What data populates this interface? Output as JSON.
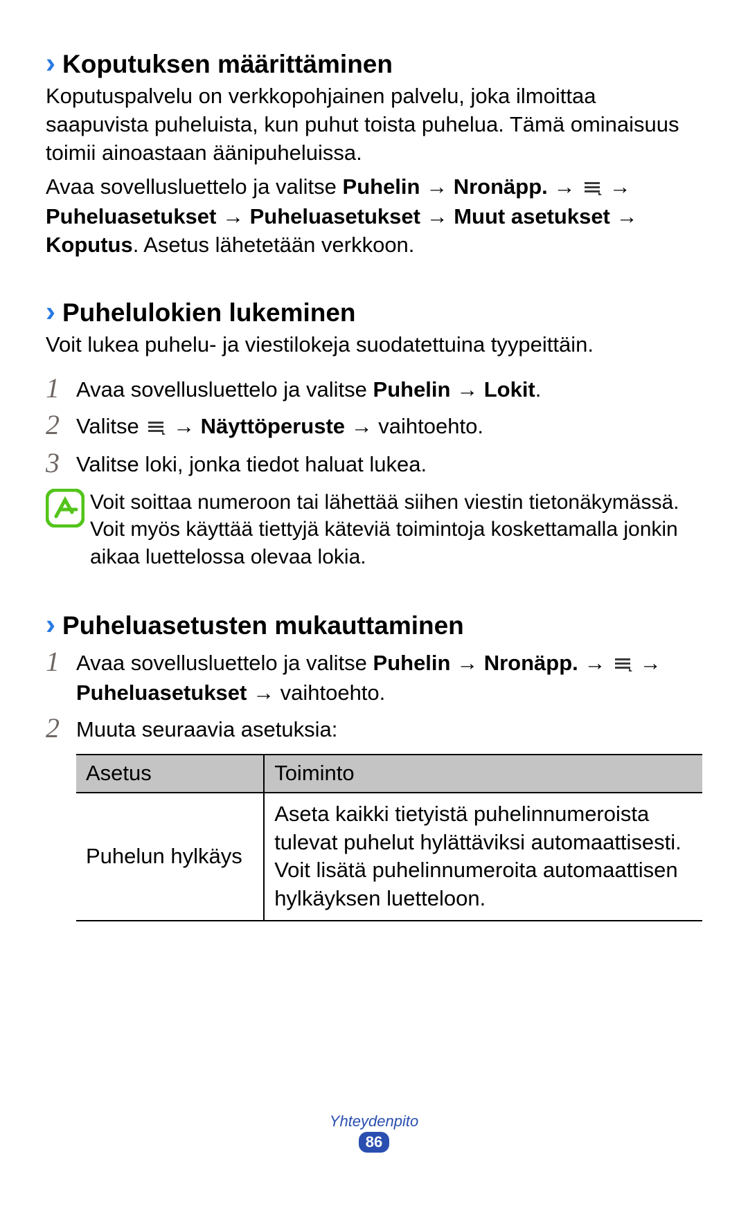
{
  "sections": {
    "s1": {
      "heading": "Koputuksen määrittäminen",
      "p1": "Koputuspalvelu on verkkopohjainen palvelu, joka ilmoittaa saapuvista puheluista, kun puhut toista puhelua. Tämä ominaisuus toimii ainoastaan äänipuheluissa.",
      "path_pre": "Avaa sovellusluettelo ja valitse ",
      "path_b1": "Puhelin",
      "arrow": " → ",
      "path_b2": "Nronäpp.",
      "path_b3": "Puheluasetukset",
      "path_b4": "Puheluasetukset",
      "path_b5": "Muut asetukset",
      "path_b6": "Koputus",
      "path_tail": ". Asetus lähetetään verkkoon."
    },
    "s2": {
      "heading": "Puhelulokien lukeminen",
      "p1": "Voit lukea puhelu- ja viestilokeja suodatettuina tyypeittäin.",
      "step1_pre": "Avaa sovellusluettelo ja valitse ",
      "step1_b1": "Puhelin",
      "step1_b2": "Lokit",
      "step1_end": ".",
      "step2_pre": "Valitse ",
      "step2_b1": "Näyttöperuste",
      "step2_tail": " → vaihtoehto.",
      "step3": "Valitse loki, jonka tiedot haluat lukea.",
      "note": "Voit soittaa numeroon tai lähettää siihen viestin tietonäkymässä. Voit myös käyttää tiettyjä käteviä toimintoja koskettamalla jonkin aikaa luettelossa olevaa lokia."
    },
    "s3": {
      "heading": "Puheluasetusten mukauttaminen",
      "step1_pre": "Avaa sovellusluettelo ja valitse ",
      "step1_b1": "Puhelin",
      "step1_b2": "Nronäpp.",
      "step1_b3": "Puheluasetukset",
      "step1_tail": " → vaihtoehto.",
      "step2": "Muuta seuraavia asetuksia:",
      "arrow": " → "
    },
    "table": {
      "h1": "Asetus",
      "h2": "Toiminto",
      "r1c1": "Puhelun hylkäys",
      "r1c2": "Aseta kaikki tietyistä puhelinnumeroista tulevat puhelut hylättäviksi automaattisesti. Voit lisätä puhelinnumeroita automaattisen hylkäyksen luetteloon."
    }
  },
  "nums": {
    "n1": "1",
    "n2": "2",
    "n3": "3"
  },
  "footer": {
    "label": "Yhteydenpito",
    "page": "86"
  }
}
